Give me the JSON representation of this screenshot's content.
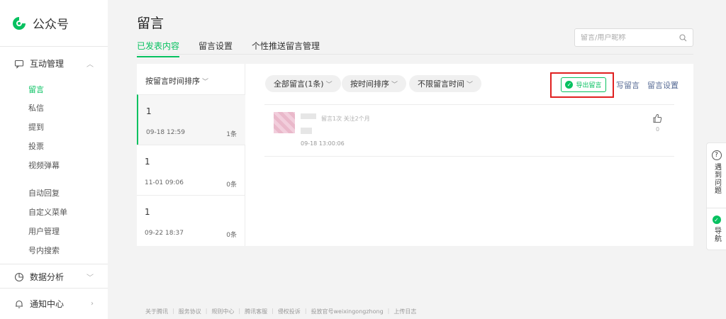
{
  "app": {
    "title": "公众号"
  },
  "sidebar": {
    "group_interaction": "互动管理",
    "items_a": [
      "留言",
      "私信",
      "提到",
      "投票",
      "视频弹幕"
    ],
    "items_b": [
      "自动回复",
      "自定义菜单",
      "用户管理",
      "号内搜索"
    ],
    "group_data": "数据分析",
    "group_notice": "通知中心"
  },
  "header": {
    "title": "留言",
    "tabs": [
      "已发表内容",
      "留言设置",
      "个性推送留言管理"
    ],
    "search_placeholder": "留言/用户昵称"
  },
  "posts": {
    "sort_label": "按留言时间排序",
    "list": [
      {
        "title": "1",
        "date": "09-18 12:59",
        "count": "1条"
      },
      {
        "title": "1",
        "date": "11-01 09:06",
        "count": "0条"
      },
      {
        "title": "1",
        "date": "09-22 18:37",
        "count": "0条"
      }
    ]
  },
  "toolbar": {
    "filter_all": "全部留言(1条)",
    "filter_sort": "按时间排序",
    "filter_time": "不限留言时间",
    "export": "导出留言",
    "write": "写留言",
    "settings": "留言设置"
  },
  "comment": {
    "meta": "留言1次 关注2个月",
    "date": "09-18 13:00:06",
    "likes": "0"
  },
  "footer": [
    "关于腾讯",
    "服务协议",
    "规则中心",
    "腾讯客服",
    "侵权投诉",
    "投放官号weixingongzhong",
    "上传日志"
  ],
  "float": {
    "help": "遇到问题",
    "nav": "导航"
  },
  "colors": {
    "accent": "#07c160",
    "link": "#576b95",
    "highlight": "#e02020"
  }
}
